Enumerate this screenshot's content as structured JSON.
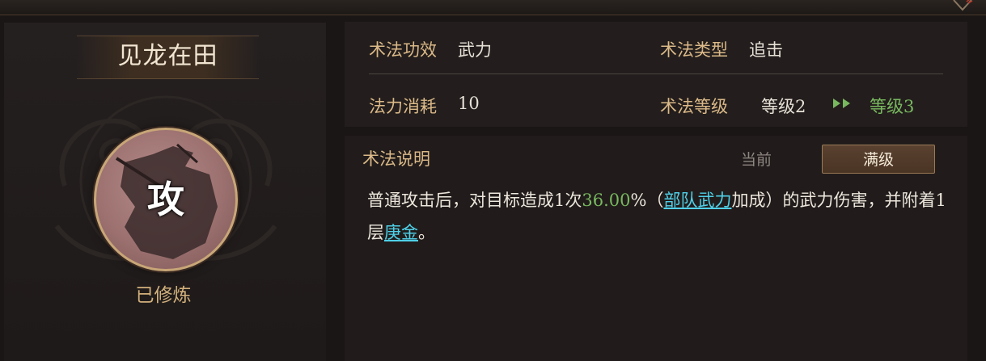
{
  "skill": {
    "name": "见龙在田",
    "emblem_char": "攻",
    "status": "已修炼"
  },
  "stats": {
    "effect_label": "术法功效",
    "effect_value": "武力",
    "type_label": "术法类型",
    "type_value": "追击",
    "cost_label": "法力消耗",
    "cost_value": "10",
    "level_label": "术法等级",
    "level_current": "等级2",
    "level_next": "等级3"
  },
  "description": {
    "title": "术法说明",
    "tab_current": "当前",
    "tab_max": "满级",
    "text_1": "普通攻击后，对目标造成1次",
    "percent": "36.00",
    "text_2": "%（",
    "link_1": "部队武力",
    "text_3": "加成）的武力伤害，并附着1层",
    "link_2": "庚金",
    "text_4": "。"
  },
  "colors": {
    "label_gold": "#dbb988",
    "highlight_green": "#78b85f",
    "link_cyan": "#4fd0e8"
  },
  "icons": [
    "close-icon",
    "double-arrow-icon",
    "swirl-pattern-icon",
    "warrior-silhouette-icon"
  ]
}
